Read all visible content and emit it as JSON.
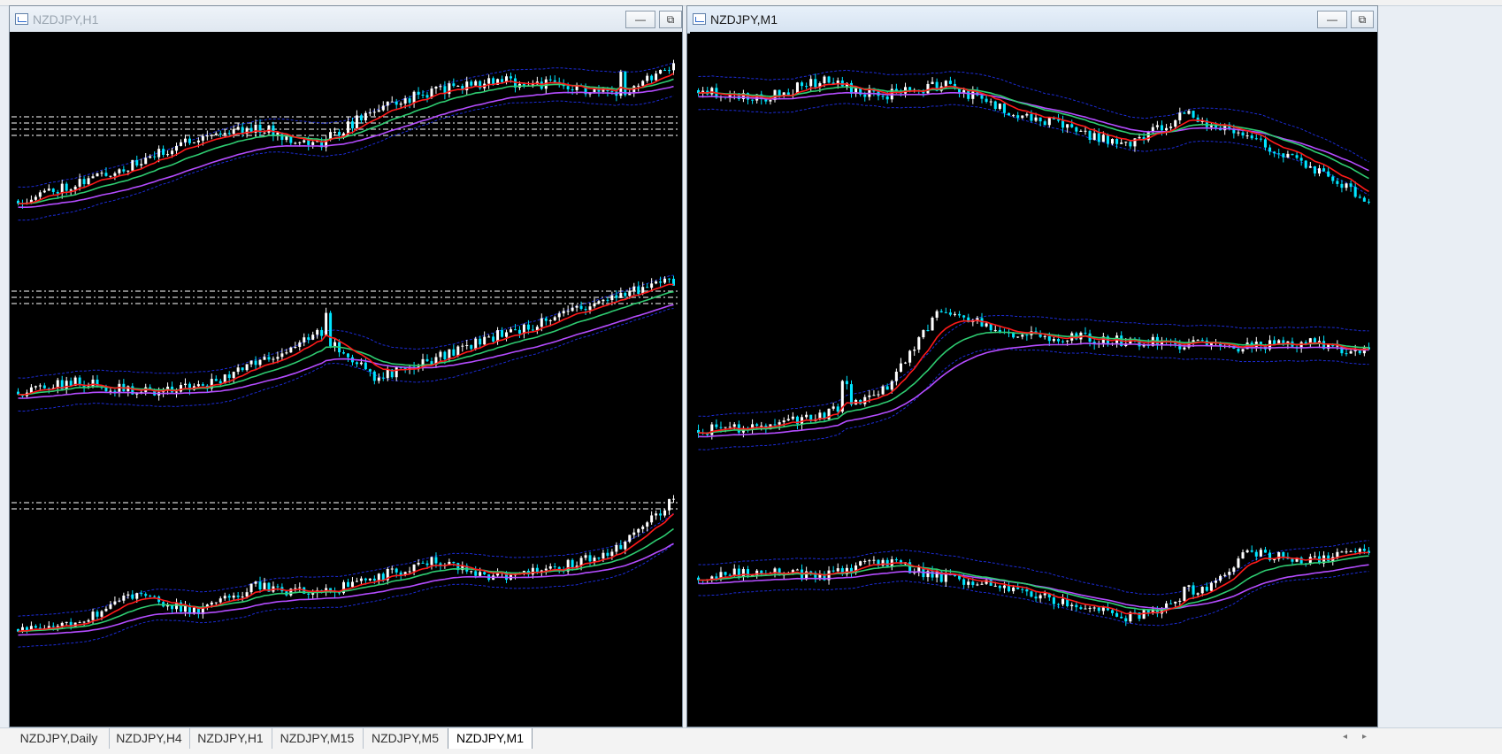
{
  "windows": {
    "left": {
      "title": "NZDJPY,H1",
      "minimize_label": "—",
      "restore_label": "⧉"
    },
    "right": {
      "title": "NZDJPY,M1",
      "minimize_label": "—",
      "restore_label": "⧉"
    }
  },
  "tabs": [
    {
      "label": "NZDJPY,Daily"
    },
    {
      "label": "NZDJPY,H4"
    },
    {
      "label": "NZDJPY,H1"
    },
    {
      "label": "NZDJPY,M15"
    },
    {
      "label": "NZDJPY,M5"
    },
    {
      "label": "NZDJPY,M1"
    }
  ],
  "active_tab_index": 5,
  "scroll": {
    "left": "◂",
    "right": "▸"
  },
  "colors": {
    "background": "#000000",
    "bull_candle": "#ffffff",
    "bear_candle": "#00e5ff",
    "ma_fast": "#ff1a1a",
    "ma_mid": "#2ecc71",
    "ma_slow": "#b44cff",
    "bollinger": "#1c2bd6",
    "level_lines": "#cfcfcf"
  },
  "panels": [
    {
      "seed": 11,
      "trend": [
        0.15,
        0.25,
        0.35,
        0.5,
        0.55,
        0.45,
        0.65,
        0.75,
        0.8,
        0.78,
        0.72,
        0.9
      ],
      "levels": 4,
      "spike": 0.92
    },
    {
      "seed": 23,
      "trend": [
        0.75,
        0.7,
        0.8,
        0.72,
        0.78,
        0.65,
        0.55,
        0.45,
        0.62,
        0.5,
        0.35,
        0.15
      ],
      "levels": 0,
      "spike": 0.0
    },
    {
      "seed": 37,
      "trend": [
        0.3,
        0.35,
        0.3,
        0.32,
        0.45,
        0.62,
        0.38,
        0.48,
        0.6,
        0.7,
        0.82,
        0.9
      ],
      "levels": 3,
      "spike": 0.47
    },
    {
      "seed": 41,
      "trend": [
        0.1,
        0.12,
        0.18,
        0.3,
        0.75,
        0.62,
        0.6,
        0.58,
        0.56,
        0.55,
        0.57,
        0.52
      ],
      "levels": 0,
      "spike": 0.22
    },
    {
      "seed": 53,
      "trend": [
        0.15,
        0.2,
        0.35,
        0.25,
        0.4,
        0.35,
        0.45,
        0.55,
        0.45,
        0.5,
        0.6,
        0.9
      ],
      "levels": 2,
      "spike": 0.0
    },
    {
      "seed": 67,
      "trend": [
        0.45,
        0.5,
        0.45,
        0.55,
        0.45,
        0.4,
        0.3,
        0.22,
        0.3,
        0.6,
        0.55,
        0.6
      ],
      "levels": 0,
      "spike": 0.73
    }
  ]
}
